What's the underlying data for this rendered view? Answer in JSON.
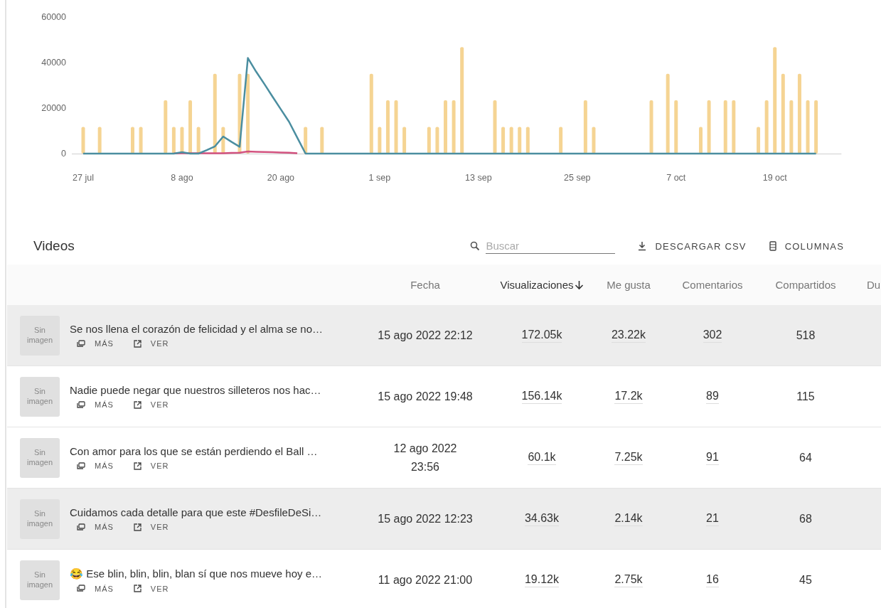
{
  "chart": {
    "chart_data": {
      "type": "bar",
      "stacked": false,
      "categories": [
        "27 jul",
        null,
        null,
        null,
        null,
        null,
        null,
        null,
        null,
        null,
        null,
        null,
        "8 ago",
        null,
        null,
        null,
        null,
        null,
        null,
        null,
        null,
        null,
        null,
        null,
        "20 ago",
        null,
        null,
        null,
        null,
        null,
        null,
        null,
        null,
        null,
        null,
        null,
        "1 sep",
        null,
        null,
        null,
        null,
        null,
        null,
        null,
        null,
        null,
        null,
        null,
        "13 sep",
        null,
        null,
        null,
        null,
        null,
        null,
        null,
        null,
        null,
        null,
        null,
        "25 sep",
        null,
        null,
        null,
        null,
        null,
        null,
        null,
        null,
        null,
        null,
        null,
        "7 oct",
        null,
        null,
        null,
        null,
        null,
        null,
        null,
        null,
        null,
        null,
        null,
        "19 oct",
        null,
        null,
        null,
        null,
        null
      ],
      "ylim": [
        0,
        60000
      ],
      "yticks": [
        0,
        20000,
        40000,
        60000
      ],
      "series": [
        {
          "color": "#f5d493",
          "values": [
            11700,
            null,
            11700,
            null,
            null,
            null,
            11700,
            11700,
            null,
            null,
            23400,
            11700,
            11700,
            23400,
            11700,
            null,
            35100,
            11700,
            null,
            35100,
            35100,
            null,
            null,
            null,
            null,
            null,
            null,
            11700,
            null,
            11700,
            null,
            null,
            null,
            null,
            null,
            35100,
            11700,
            23400,
            23400,
            11700,
            null,
            null,
            11700,
            11700,
            23400,
            23400,
            46800,
            null,
            null,
            null,
            23400,
            11700,
            11700,
            11700,
            11700,
            null,
            null,
            null,
            11700,
            null,
            null,
            23400,
            11700,
            null,
            null,
            null,
            null,
            null,
            null,
            23400,
            null,
            35100,
            23400,
            null,
            null,
            11700,
            23400,
            null,
            23400,
            23400,
            null,
            null,
            11700,
            23400,
            46800,
            35100,
            23400,
            35100,
            23400,
            23400
          ]
        },
        {
          "type": "line",
          "color": "#d2527f",
          "values": [
            null,
            null,
            null,
            null,
            null,
            null,
            null,
            null,
            null,
            null,
            null,
            100,
            200,
            200,
            200,
            200,
            200,
            200,
            300,
            400,
            900,
            800,
            700,
            600,
            500,
            400,
            200,
            null,
            null,
            null,
            null,
            null,
            null,
            null,
            null,
            null,
            null,
            null,
            null,
            null,
            null,
            null,
            null,
            null,
            null,
            null,
            null,
            null,
            null,
            null,
            null,
            null,
            null,
            null,
            null,
            null,
            null,
            null,
            null,
            null,
            null,
            null,
            null,
            null,
            null,
            null,
            null,
            null,
            null,
            null,
            null,
            null,
            null,
            null,
            null,
            null,
            null,
            null,
            null,
            null,
            null,
            null,
            null,
            null,
            null,
            null,
            null,
            null,
            null,
            null
          ]
        },
        {
          "type": "line",
          "color": "#4b8ea0",
          "values": [
            0,
            0,
            0,
            0,
            0,
            0,
            0,
            0,
            0,
            0,
            0,
            0,
            600,
            0,
            0,
            1500,
            3200,
            7500,
            5200,
            3000,
            42000,
            36000,
            30600,
            25000,
            19500,
            14000,
            7000,
            0,
            0,
            0,
            0,
            0,
            0,
            0,
            0,
            0,
            0,
            0,
            0,
            0,
            0,
            0,
            0,
            0,
            0,
            0,
            0,
            0,
            0,
            0,
            0,
            0,
            0,
            0,
            0,
            0,
            0,
            0,
            0,
            0,
            0,
            0,
            0,
            0,
            0,
            0,
            0,
            0,
            0,
            0,
            0,
            0,
            0,
            0,
            0,
            0,
            0,
            0,
            0,
            0,
            0,
            0,
            0,
            0,
            0,
            0,
            0,
            0,
            0,
            0
          ]
        }
      ]
    }
  },
  "videos": {
    "title": "Videos",
    "search": {
      "placeholder": "Buscar"
    },
    "download_button": "DESCARGAR CSV",
    "columns_button": "COLUMNAS",
    "table": {
      "columns": [
        {
          "label": "Fecha",
          "sorted": false
        },
        {
          "label": "Visualizaciones",
          "sorted": true
        },
        {
          "label": "Me gusta",
          "sorted": false
        },
        {
          "label": "Comentarios",
          "sorted": false
        },
        {
          "label": "Compartidos",
          "sorted": false
        },
        {
          "label": "Du",
          "sorted": false
        }
      ],
      "rows": [
        {
          "highlighted": true,
          "thumbnail": "Sin imagen",
          "title": "Se nos llena el corazón de felicidad y el alma se no…",
          "more": "MÁS",
          "view": "VER",
          "date": "15 ago 2022 22:12",
          "views": "172.05k",
          "likes": "23.22k",
          "comments": "302",
          "shares": "518"
        },
        {
          "highlighted": false,
          "thumbnail": "Sin imagen",
          "title": "Nadie puede negar que nuestros silleteros nos hac…",
          "more": "MÁS",
          "view": "VER",
          "date": "15 ago 2022 19:48",
          "views": "156.14k",
          "likes": "17.2k",
          "comments": "89",
          "shares": "115"
        },
        {
          "highlighted": false,
          "thumbnail": "Sin imagen",
          "title": "Con amor para los que se están perdiendo el Ball …",
          "more": "MÁS",
          "view": "VER",
          "date": "12 ago 2022\n23:56",
          "views": "60.1k",
          "likes": "7.25k",
          "comments": "91",
          "shares": "64"
        },
        {
          "highlighted": true,
          "thumbnail": "Sin imagen",
          "title": "Cuidamos cada detalle para que este #DesfileDeSi…",
          "more": "MÁS",
          "view": "VER",
          "date": "15 ago 2022 12:23",
          "views": "34.63k",
          "likes": "2.14k",
          "comments": "21",
          "shares": "68"
        },
        {
          "highlighted": false,
          "thumbnail": "Sin imagen",
          "title": "😂 Ese blin, blin, blin, blan sí que nos mueve hoy e…",
          "more": "MÁS",
          "view": "VER",
          "date": "11 ago 2022 21:00",
          "views": "19.12k",
          "likes": "2.75k",
          "comments": "16",
          "shares": "45"
        }
      ]
    }
  }
}
